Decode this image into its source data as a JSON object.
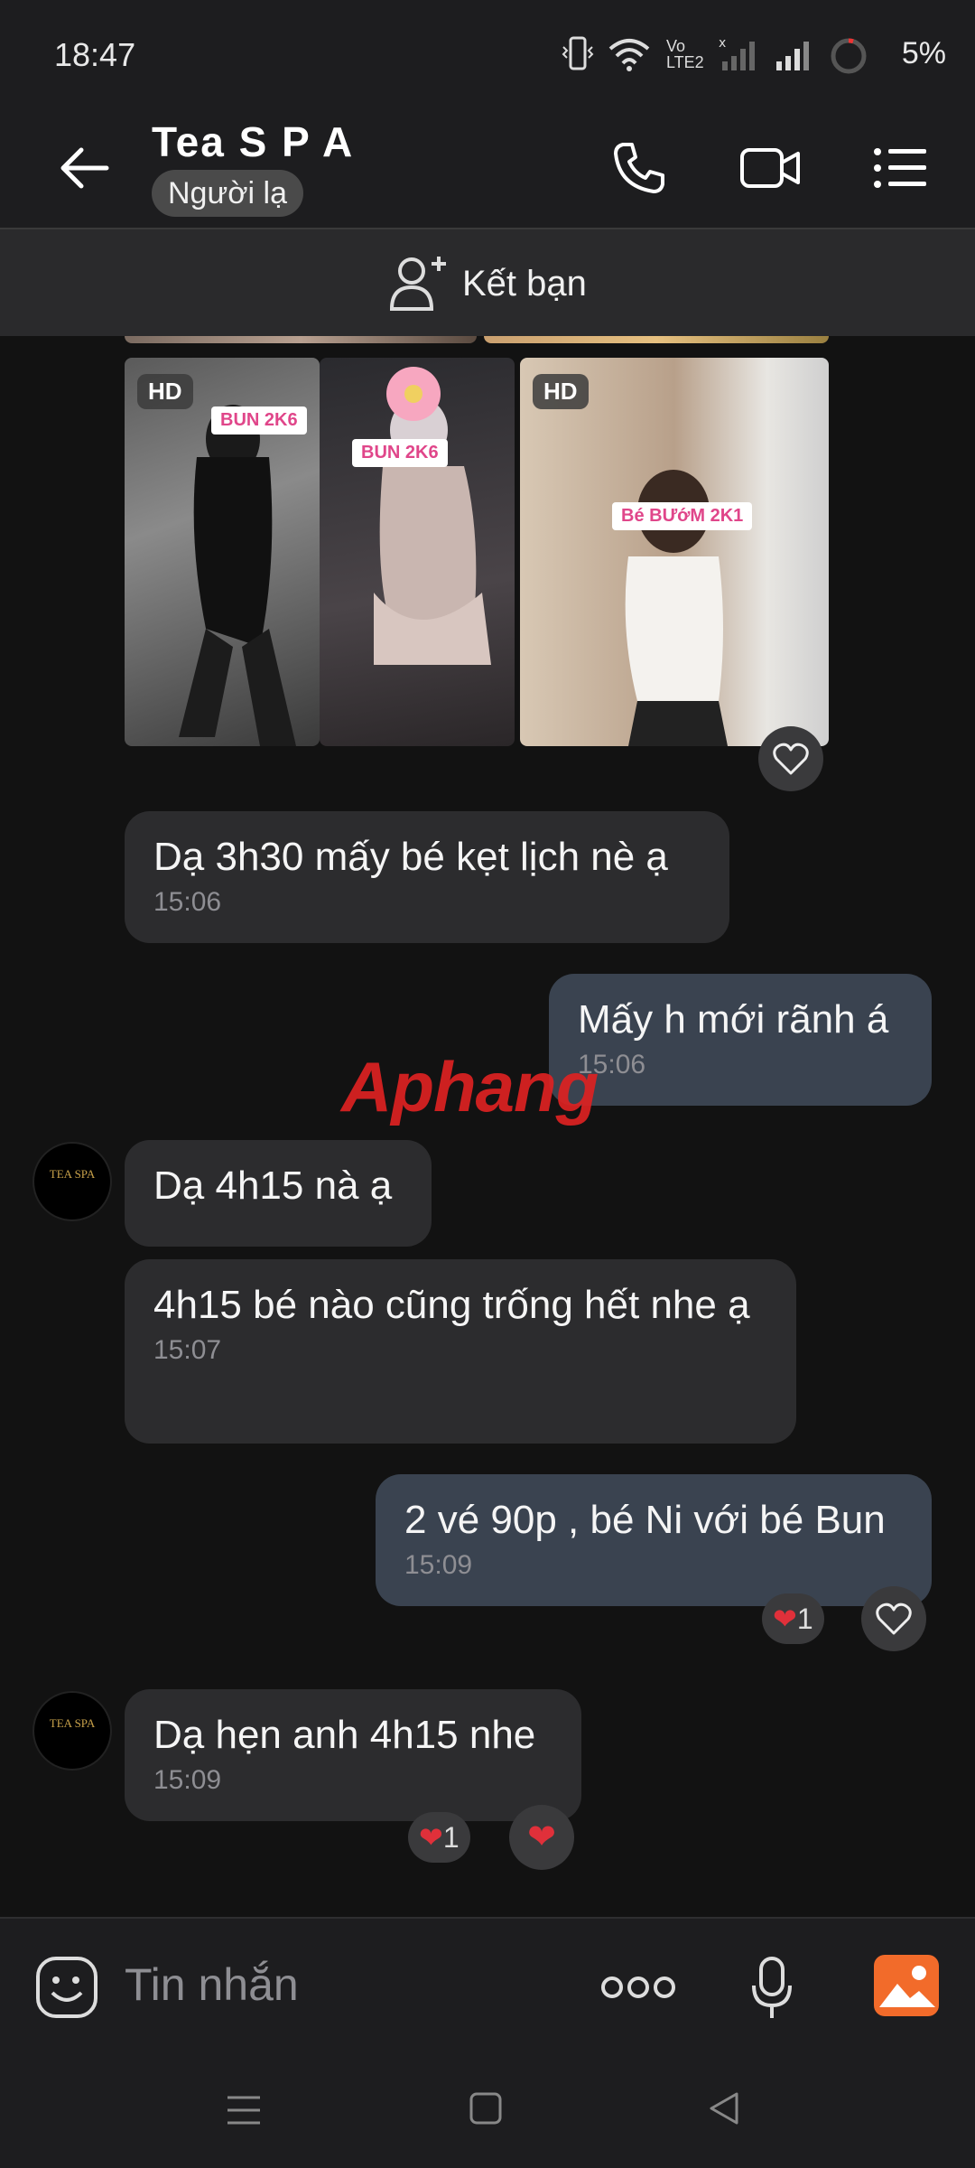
{
  "status_bar": {
    "time": "18:47",
    "battery": "5%",
    "network_label": "Vo LTE2"
  },
  "header": {
    "title": "Tea S P A",
    "badge": "Người lạ"
  },
  "add_friend": {
    "label": "Kết bạn"
  },
  "gallery": {
    "tiles": [
      {
        "hd": "HD",
        "tag": "BUN 2K6"
      },
      {
        "tag": "BUN 2K6"
      },
      {
        "hd": "HD",
        "tag": "Bé BƯớM 2K1"
      }
    ]
  },
  "messages": [
    {
      "side": "them",
      "text": "Dạ 3h30 mấy bé kẹt lịch nè ạ",
      "time": "15:06"
    },
    {
      "side": "me",
      "text": "Mấy h mới rãnh á",
      "time": "15:06"
    },
    {
      "side": "them",
      "text": "Dạ 4h15 nà ạ",
      "time": ""
    },
    {
      "side": "them",
      "text": "4h15 bé nào cũng trống hết nhe ạ",
      "time": "15:07"
    },
    {
      "side": "me",
      "text": "2 vé 90p , bé Ni với bé Bun",
      "time": "15:09",
      "reaction_count": "1"
    },
    {
      "side": "them",
      "text": "Dạ hẹn anh 4h15 nhe",
      "time": "15:09",
      "reaction_count": "1"
    }
  ],
  "avatar_text": "TEA SPA",
  "watermark": "Aphang",
  "composer": {
    "placeholder": "Tin nhắn"
  },
  "colors": {
    "accent_heart": "#e0303a",
    "photo_button": "#f26b2a"
  }
}
